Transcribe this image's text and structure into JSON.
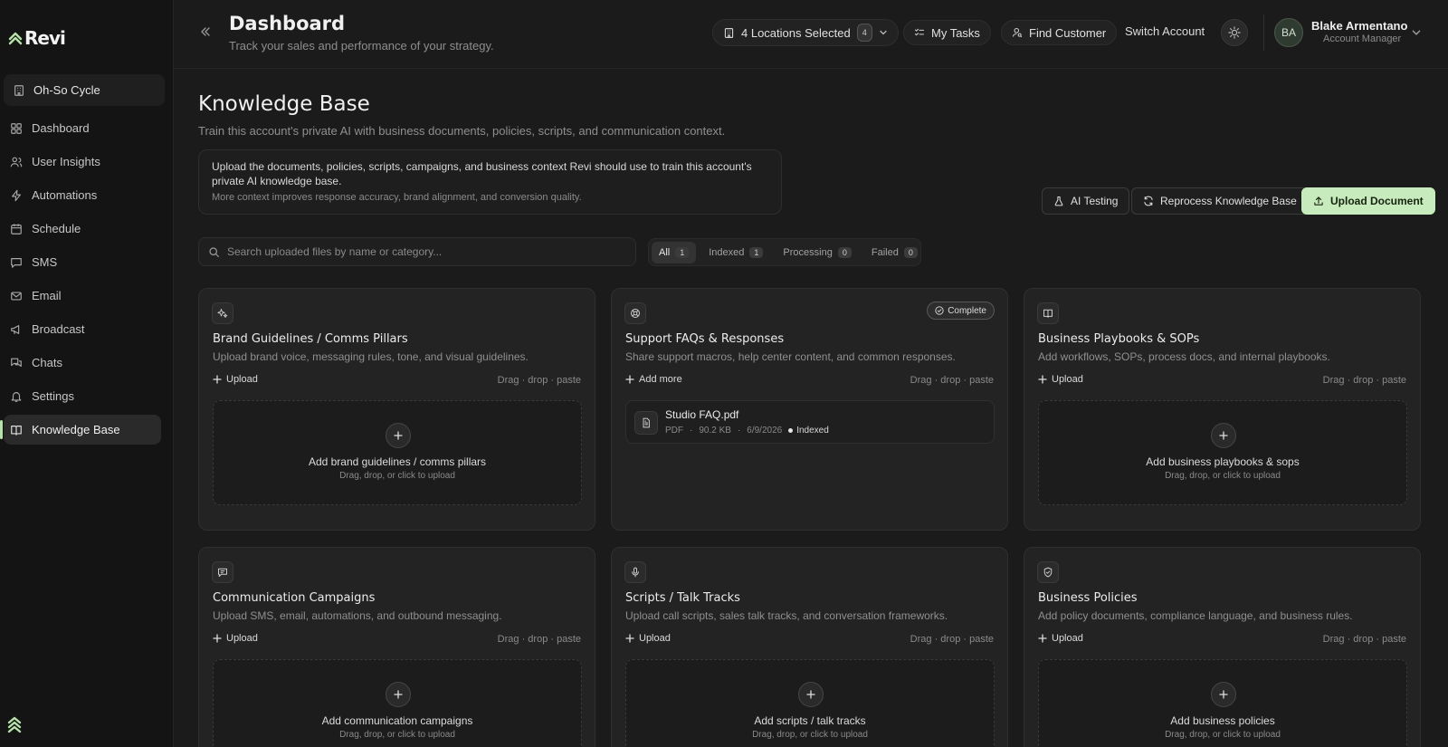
{
  "brand": {
    "name": "Revi",
    "accent": "#b6e3a8"
  },
  "sidebar": {
    "account": "Oh-So Cycle",
    "items": [
      {
        "label": "Dashboard",
        "icon": "grid-icon"
      },
      {
        "label": "User Insights",
        "icon": "users-icon"
      },
      {
        "label": "Automations",
        "icon": "bolt-icon"
      },
      {
        "label": "Schedule",
        "icon": "calendar-icon"
      },
      {
        "label": "SMS",
        "icon": "message-icon"
      },
      {
        "label": "Email",
        "icon": "mail-icon"
      },
      {
        "label": "Broadcast",
        "icon": "megaphone-icon"
      },
      {
        "label": "Chats",
        "icon": "chat-icon"
      },
      {
        "label": "Settings",
        "icon": "bell-icon"
      },
      {
        "label": "Knowledge Base",
        "icon": "book-icon",
        "active": true
      }
    ]
  },
  "header": {
    "title": "Dashboard",
    "subtitle": "Track your sales and performance of your strategy.",
    "locations_label": "4 Locations Selected",
    "locations_count": "4",
    "my_tasks": "My Tasks",
    "find_customer": "Find Customer",
    "switch_account": "Switch Account",
    "user": {
      "initials": "BA",
      "name": "Blake Armentano",
      "role": "Account Manager"
    }
  },
  "kb": {
    "title": "Knowledge Base",
    "subtitle": "Train this account's private AI with business documents, policies, scripts, and communication context.",
    "info_main": "Upload the documents, policies, scripts, campaigns, and business context Revi should use to train this account's private AI knowledge base.",
    "info_small": "More context improves response accuracy, brand alignment, and conversion quality.",
    "actions": {
      "ai_testing": "AI Testing",
      "reprocess": "Reprocess Knowledge Base",
      "upload": "Upload Document"
    },
    "search_placeholder": "Search uploaded files by name or category...",
    "filters": [
      {
        "label": "All",
        "count": "1"
      },
      {
        "label": "Indexed",
        "count": "1"
      },
      {
        "label": "Processing",
        "count": "0"
      },
      {
        "label": "Failed",
        "count": "0"
      }
    ],
    "upload_label": "Upload",
    "add_more_label": "Add more",
    "hint": "Drag · drop · paste",
    "dz_sub": "Drag, drop, or click to upload",
    "cards": [
      {
        "title": "Brand Guidelines / Comms Pillars",
        "desc": "Upload brand voice, messaging rules, tone, and visual guidelines.",
        "dz_title": "Add brand guidelines / comms pillars",
        "icon": "sparkle-icon"
      },
      {
        "title": "Support FAQs & Responses",
        "desc": "Share support macros, help center content, and common responses.",
        "badge": "Complete",
        "icon": "lifebuoy-icon",
        "file": {
          "name": "Studio FAQ.pdf",
          "type": "PDF",
          "size": "90.2 KB",
          "date": "6/9/2026",
          "status": "Indexed"
        }
      },
      {
        "title": "Business Playbooks & SOPs",
        "desc": "Add workflows, SOPs, process docs, and internal playbooks.",
        "dz_title": "Add business playbooks & sops",
        "icon": "book-open-icon"
      },
      {
        "title": "Communication Campaigns",
        "desc": "Upload SMS, email, automations, and outbound messaging.",
        "dz_title": "Add communication campaigns",
        "icon": "message-square-icon"
      },
      {
        "title": "Scripts / Talk Tracks",
        "desc": "Upload call scripts, sales talk tracks, and conversation frameworks.",
        "dz_title": "Add scripts / talk tracks",
        "icon": "mic-icon"
      },
      {
        "title": "Business Policies",
        "desc": "Add policy documents, compliance language, and business rules.",
        "dz_title": "Add business policies",
        "icon": "shield-check-icon"
      }
    ]
  }
}
